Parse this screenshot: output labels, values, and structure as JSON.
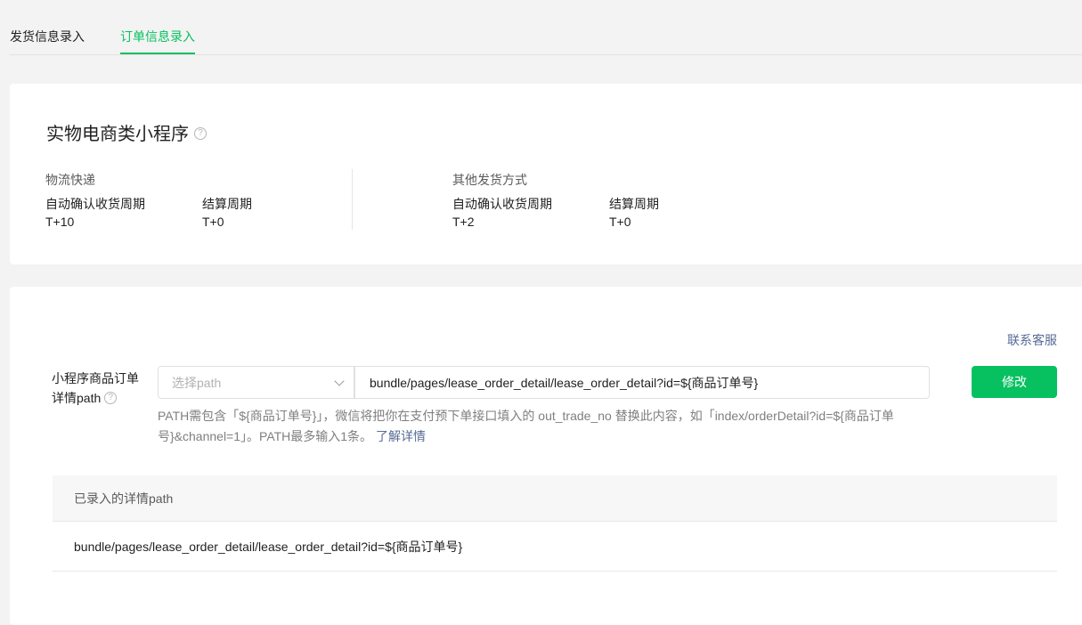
{
  "tabs": [
    {
      "label": "发货信息录入",
      "active": false
    },
    {
      "label": "订单信息录入",
      "active": true
    }
  ],
  "accent_color": "#07c160",
  "link_color": "#576b95",
  "category_card": {
    "title": "实物电商类小程序",
    "logistics": {
      "section_label": "物流快递",
      "confirm_label": "自动确认收货周期",
      "confirm_value": "T+10",
      "settle_label": "结算周期",
      "settle_value": "T+0"
    },
    "other_shipping": {
      "section_label": "其他发货方式",
      "confirm_label": "自动确认收货周期",
      "confirm_value": "T+2",
      "settle_label": "结算周期",
      "settle_value": "T+0"
    }
  },
  "path_card": {
    "contact_link": "联系客服",
    "field_label": "小程序商品订单详情path",
    "select_placeholder": "选择path",
    "path_value": "bundle/pages/lease_order_detail/lease_order_detail?id=${商品订单号}",
    "modify_button": "修改",
    "hint_text": "PATH需包含「${商品订单号}」，微信将把你在支付预下单接口填入的 out_trade_no 替换此内容，如「index/orderDetail?id=${商品订单号}&channel=1」。PATH最多输入1条。",
    "hint_link": "了解详情",
    "table_header": "已录入的详情path",
    "table_rows": [
      "bundle/pages/lease_order_detail/lease_order_detail?id=${商品订单号}"
    ]
  }
}
